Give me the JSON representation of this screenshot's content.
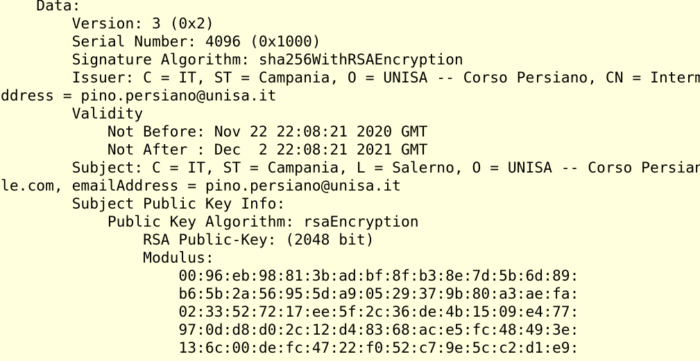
{
  "background_color": "#FFFFDD",
  "text_color": "#000000",
  "lines": [
    "    Data:",
    "        Version: 3 (0x2)",
    "        Serial Number: 4096 (0x1000)",
    "        Signature Algorithm: sha256WithRSAEncryption",
    "        Issuer: C = IT, ST = Campania, O = UNISA -- Corso Persiano, CN = Intermediate CA, emailAddress = pino.persiano@unisa.it",
    "        Validity",
    "            Not Before: Nov 22 22:08:21 2020 GMT",
    "            Not After : Dec  2 22:08:21 2021 GMT",
    "        Subject: C = IT, ST = Campania, L = Salerno, O = UNISA -- Corso Persiano, CN = www.example.com, emailAddress = pino.persiano@unisa.it",
    "        Subject Public Key Info:",
    "            Public Key Algorithm: rsaEncryption",
    "                RSA Public-Key: (2048 bit)",
    "                Modulus:",
    "                    00:96:eb:98:81:3b:ad:bf:8f:b3:8e:7d:5b:6d:89:",
    "                    b6:5b:2a:56:95:5d:a9:05:29:37:9b:80:a3:ae:fa:",
    "                    02:33:52:72:17:ee:5f:2c:36:de:4b:15:09:e4:77:",
    "                    97:0d:d8:d0:2c:12:d4:83:68:ac:e5:fc:48:49:3e:",
    "                    13:6c:00:de:fc:47:22:f0:52:c7:9e:5c:c2:d1:e9:"
  ]
}
